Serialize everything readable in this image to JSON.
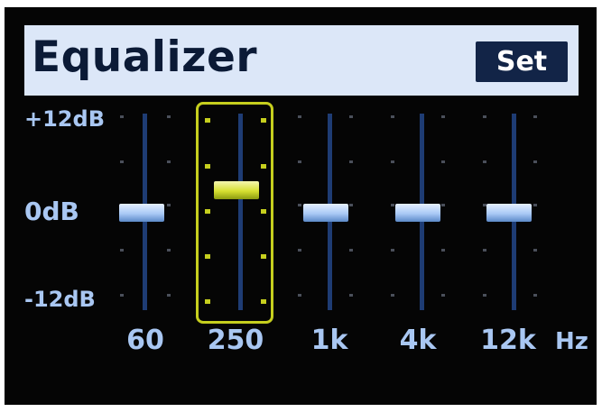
{
  "header": {
    "title": "Equalizer",
    "set_label": "Set"
  },
  "scale": {
    "top_label": "+12dB",
    "mid_label": "0dB",
    "bottom_label": "-12dB",
    "max_db": 12,
    "min_db": -12
  },
  "bands": [
    {
      "label": "60",
      "gain_db": 0,
      "selected": false
    },
    {
      "label": "250",
      "gain_db": 3,
      "selected": true
    },
    {
      "label": "1k",
      "gain_db": 0,
      "selected": false
    },
    {
      "label": "4k",
      "gain_db": 0,
      "selected": false
    },
    {
      "label": "12k",
      "gain_db": 0,
      "selected": false
    }
  ],
  "unit_label": "Hz",
  "colors": {
    "header_bg": "#dce7f8",
    "title_text": "#0b1a36",
    "set_bg": "#122447",
    "label_text": "#a9c7f2",
    "track": "#1e3c74",
    "selection": "#c6cf1e"
  }
}
